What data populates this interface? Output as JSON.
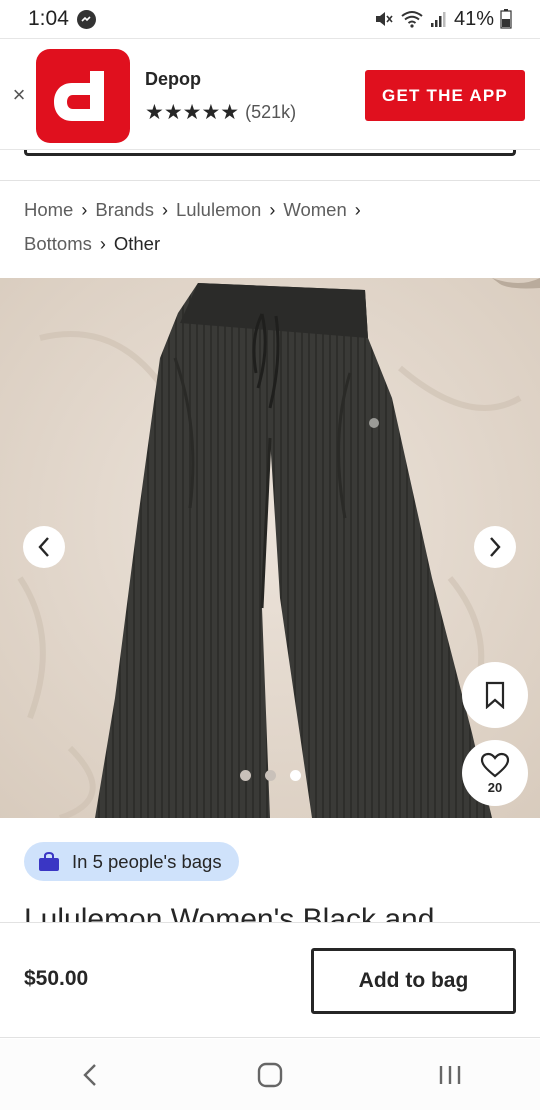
{
  "status_bar": {
    "time": "1:04",
    "battery": "41%"
  },
  "app_banner": {
    "app_name": "Depop",
    "stars": "★★★★★",
    "rating_count": "(521k)",
    "cta_label": "GET THE APP",
    "close_label": "×",
    "brand_color": "#e0101e"
  },
  "breadcrumb": {
    "items": [
      "Home",
      "Brands",
      "Lululemon",
      "Women",
      "Bottoms",
      "Other"
    ],
    "separator": "›"
  },
  "gallery": {
    "image_count": 3,
    "active_index": 2
  },
  "product": {
    "likes": "20",
    "bags_badge": "In 5 people's bags",
    "title_partial": "Lululemon Women's Black and",
    "price": "$50.00",
    "add_to_bag_label": "Add to bag"
  },
  "colors": {
    "badge_bg": "#cfe2fb",
    "bag_icon": "#3a36c4"
  }
}
